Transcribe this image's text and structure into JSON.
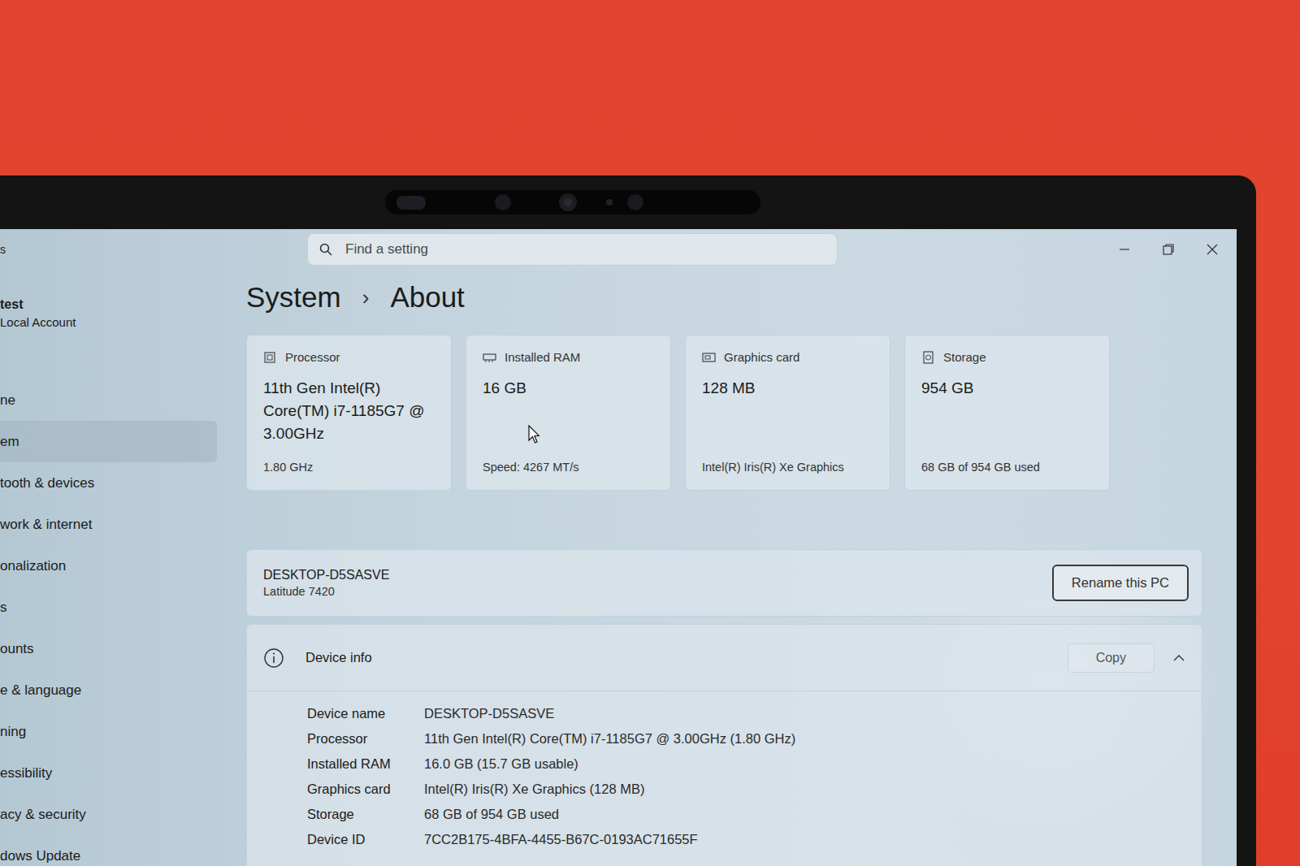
{
  "window": {
    "app_title": "s"
  },
  "search": {
    "placeholder": "Find a setting"
  },
  "account": {
    "name": "test",
    "type": "Local Account"
  },
  "sidebar": {
    "items": [
      {
        "label": "ne",
        "selected": false
      },
      {
        "label": "em",
        "selected": true
      },
      {
        "label": "tooth & devices",
        "selected": false
      },
      {
        "label": "work & internet",
        "selected": false
      },
      {
        "label": "onalization",
        "selected": false
      },
      {
        "label": "s",
        "selected": false
      },
      {
        "label": "ounts",
        "selected": false
      },
      {
        "label": "e & language",
        "selected": false
      },
      {
        "label": "ning",
        "selected": false
      },
      {
        "label": "essibility",
        "selected": false
      },
      {
        "label": "acy & security",
        "selected": false
      },
      {
        "label": "dows Update",
        "selected": false
      }
    ]
  },
  "breadcrumb": {
    "items": [
      "System",
      "About"
    ],
    "separator": "›"
  },
  "cards": [
    {
      "kind": "processor",
      "label": "Processor",
      "value": "11th Gen Intel(R) Core(TM) i7-1185G7 @ 3.00GHz",
      "detail": "1.80 GHz"
    },
    {
      "kind": "ram",
      "label": "Installed RAM",
      "value": "16 GB",
      "detail": "Speed: 4267 MT/s"
    },
    {
      "kind": "graphics",
      "label": "Graphics card",
      "value": "128 MB",
      "detail": "Intel(R) Iris(R) Xe Graphics"
    },
    {
      "kind": "storage",
      "label": "Storage",
      "value": "954 GB",
      "detail": "68 GB of 954 GB used"
    }
  ],
  "device": {
    "name": "DESKTOP-D5SASVE",
    "model": "Latitude 7420",
    "button": "Rename this PC"
  },
  "device_info": {
    "title": "Device info",
    "button": "Copy",
    "expanded": true,
    "rows": [
      {
        "label": "Device name",
        "value": "DESKTOP-D5SASVE"
      },
      {
        "label": "Processor",
        "value": "11th Gen Intel(R) Core(TM) i7-1185G7 @ 3.00GHz (1.80 GHz)"
      },
      {
        "label": "Installed RAM",
        "value": "16.0 GB (15.7 GB usable)"
      },
      {
        "label": "Graphics card",
        "value": "Intel(R) Iris(R) Xe Graphics (128 MB)"
      },
      {
        "label": "Storage",
        "value": "68 GB of 954 GB used"
      },
      {
        "label": "Device ID",
        "value": "7CC2B175-4BFA-4455-B67C-0193AC71655F"
      }
    ]
  }
}
